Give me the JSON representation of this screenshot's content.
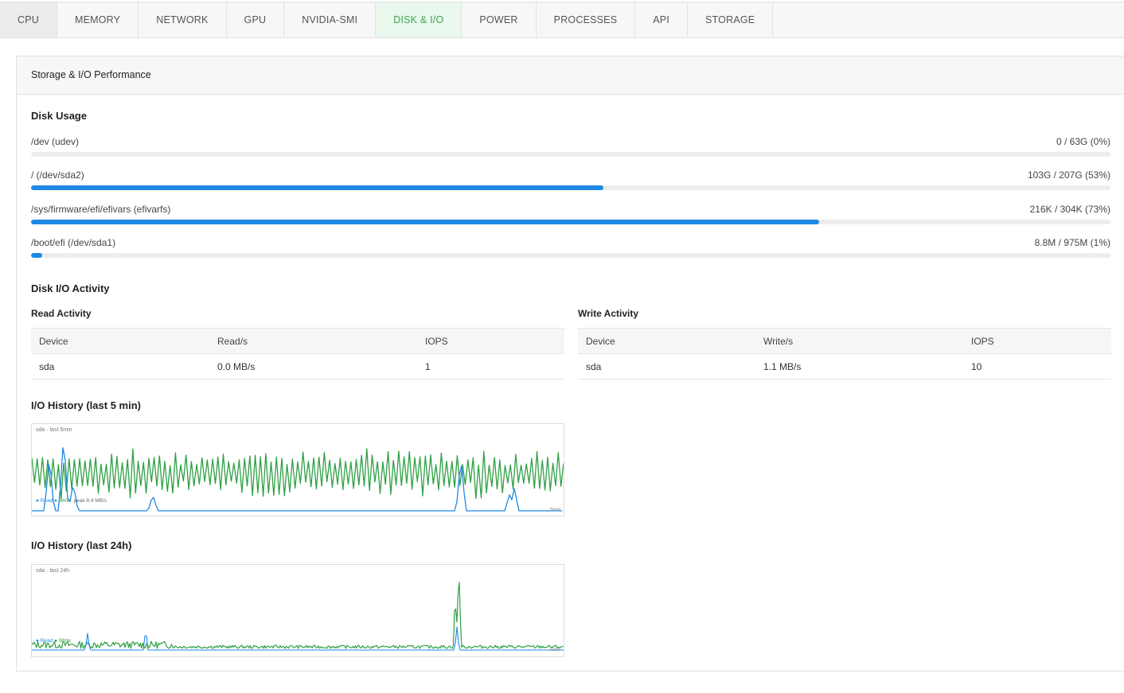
{
  "tabs": [
    {
      "label": "CPU"
    },
    {
      "label": "MEMORY"
    },
    {
      "label": "NETWORK"
    },
    {
      "label": "GPU"
    },
    {
      "label": "NVIDIA-SMI"
    },
    {
      "label": "DISK & I/O"
    },
    {
      "label": "POWER"
    },
    {
      "label": "PROCESSES"
    },
    {
      "label": "API"
    },
    {
      "label": "STORAGE"
    }
  ],
  "active_tab": "DISK & I/O",
  "panel_title": "Storage & I/O Performance",
  "disk_usage": {
    "title": "Disk Usage",
    "mounts": [
      {
        "label": "/dev (udev)",
        "value": "0 / 63G (0%)",
        "percent": 0
      },
      {
        "label": "/ (/dev/sda2)",
        "value": "103G / 207G (53%)",
        "percent": 53
      },
      {
        "label": "/sys/firmware/efi/efivars (efivarfs)",
        "value": "216K / 304K (73%)",
        "percent": 73
      },
      {
        "label": "/boot/efi (/dev/sda1)",
        "value": "8.8M / 975M (1%)",
        "percent": 1
      }
    ]
  },
  "disk_io": {
    "title": "Disk I/O Activity",
    "read": {
      "title": "Read Activity",
      "headers": [
        "Device",
        "Read/s",
        "IOPS"
      ],
      "rows": [
        [
          "sda",
          "0.0 MB/s",
          "1"
        ]
      ]
    },
    "write": {
      "title": "Write Activity",
      "headers": [
        "Device",
        "Write/s",
        "IOPS"
      ],
      "rows": [
        [
          "sda",
          "1.1 MB/s",
          "10"
        ]
      ]
    }
  },
  "history_5min": {
    "title": "I/O History (last 5 min)",
    "caption": "sda · last 5min",
    "legend_read": "● Read",
    "legend_write": "● Write",
    "peak": "peak 8.4 MB/s",
    "now": "Now"
  },
  "history_24h": {
    "title": "I/O History (last 24h)",
    "caption": "sda · last 24h",
    "legend_read": "● Read",
    "legend_write": "● Write",
    "now": "Now"
  },
  "colors": {
    "read": "#1e88e5",
    "write": "#2ea043",
    "accent": "#3ca64f"
  }
}
